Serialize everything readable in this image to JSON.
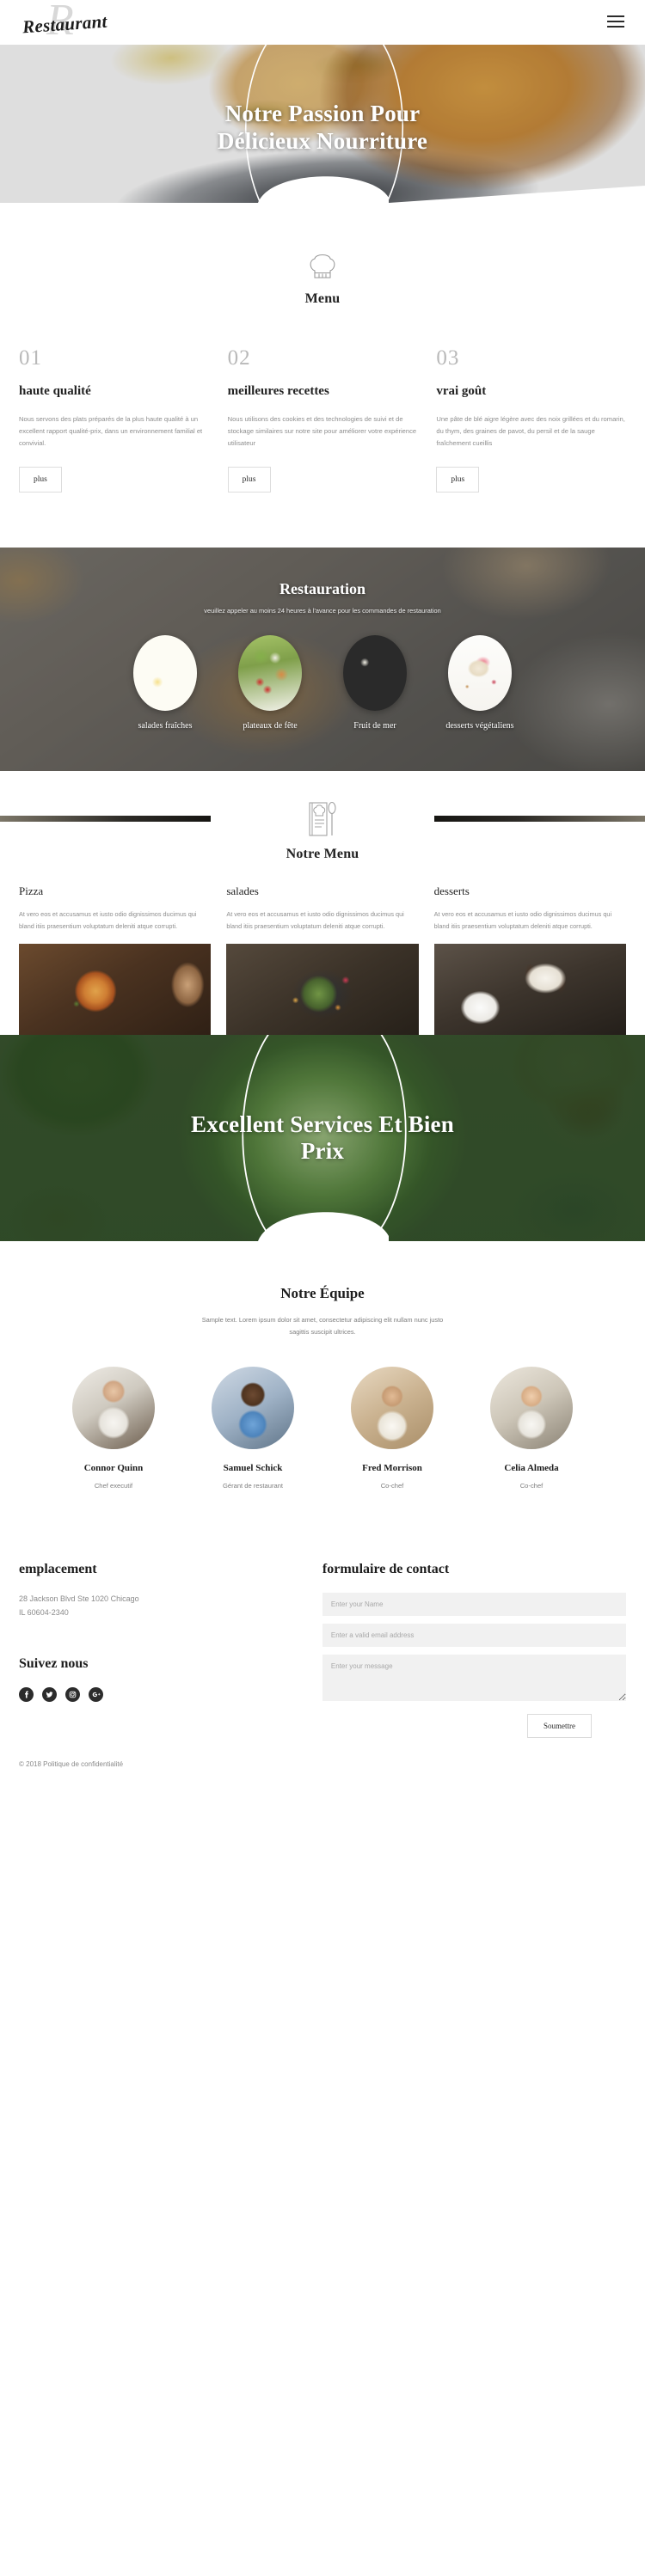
{
  "header": {
    "logo_text": "Restaurant",
    "logo_watermark": "R",
    "menu_icon": "hamburger-icon"
  },
  "hero_primary": {
    "title": "Notre Passion Pour Délicieux Nourriture"
  },
  "menu_intro": {
    "icon": "chef-hat-icon",
    "title": "Menu"
  },
  "features": [
    {
      "number": "01",
      "heading": "haute qualité",
      "text": "Nous servons des plats préparés de la plus haute qualité à un excellent rapport qualité-prix, dans un environnement familial et convivial.",
      "button": "plus"
    },
    {
      "number": "02",
      "heading": "meilleures recettes",
      "text": "Nous utilisons des cookies et des technologies de suivi et de stockage similaires sur notre site pour améliorer votre expérience utilisateur",
      "button": "plus"
    },
    {
      "number": "03",
      "heading": "vrai goût",
      "text": "Une pâte de blé aigre légère avec des noix grillées et du romarin, du thym, des graines de pavot, du persil et de la sauge fraîchement cueillis",
      "button": "plus"
    }
  ],
  "catering": {
    "title": "Restauration",
    "subtitle": "veuillez appeler au moins 24 heures à l'avance pour les commandes de restauration",
    "items": [
      {
        "label": "salades fraîches",
        "image": "fresh-salad-photo"
      },
      {
        "label": "plateaux de fête",
        "image": "party-platter-photo"
      },
      {
        "label": "Fruit de mer",
        "image": "seafood-photo"
      },
      {
        "label": "desserts végétaliens",
        "image": "vegan-dessert-photo"
      }
    ]
  },
  "notre_menu": {
    "icon": "menu-book-icon",
    "title": "Notre Menu",
    "columns": [
      {
        "heading": "Pizza",
        "text": "At vero eos et accusamus et iusto odio dignissimos ducimus qui bland itiis praesentium voluptatum deleniti atque corrupti.",
        "image": "pizza-photo"
      },
      {
        "heading": "salades",
        "text": "At vero eos et accusamus et iusto odio dignissimos ducimus qui bland itiis praesentium voluptatum deleniti atque corrupti.",
        "image": "salad-bowl-photo"
      },
      {
        "heading": "desserts",
        "text": "At vero eos et accusamus et iusto odio dignissimos ducimus qui bland itiis praesentium voluptatum deleniti atque corrupti.",
        "image": "dessert-photo"
      }
    ]
  },
  "hero_secondary": {
    "title": "Excellent Services Et Bien Prix"
  },
  "team": {
    "title": "Notre Équipe",
    "subtitle": "Sample text. Lorem ipsum dolor sit amet, consectetur adipiscing elit nullam nunc justo sagittis suscipit ultrices.",
    "members": [
      {
        "name": "Connor Quinn",
        "role": "Chef executif",
        "avatar": "chef-portrait"
      },
      {
        "name": "Samuel Schick",
        "role": "Gérant de restaurant",
        "avatar": "manager-portrait"
      },
      {
        "name": "Fred Morrison",
        "role": "Co-chef",
        "avatar": "cochef-portrait"
      },
      {
        "name": "Celia Almeda",
        "role": "Co-chef",
        "avatar": "cochef2-portrait"
      }
    ]
  },
  "footer": {
    "location_title": "emplacement",
    "address_line1": "28 Jackson Blvd Ste 1020 Chicago",
    "address_line2": "IL 60604-2340",
    "follow_title": "Suivez nous",
    "social": [
      {
        "name": "facebook-icon",
        "glyph": "f"
      },
      {
        "name": "twitter-icon",
        "glyph": "t"
      },
      {
        "name": "instagram-icon",
        "glyph": "i"
      },
      {
        "name": "googleplus-icon",
        "glyph": "G+"
      }
    ],
    "form_title": "formulaire de contact",
    "name_placeholder": "Enter your Name",
    "email_placeholder": "Enter a valid email address",
    "message_placeholder": "Enter your message",
    "submit_label": "Soumettre",
    "copyright": "© 2018 Politique de confidentialité"
  }
}
